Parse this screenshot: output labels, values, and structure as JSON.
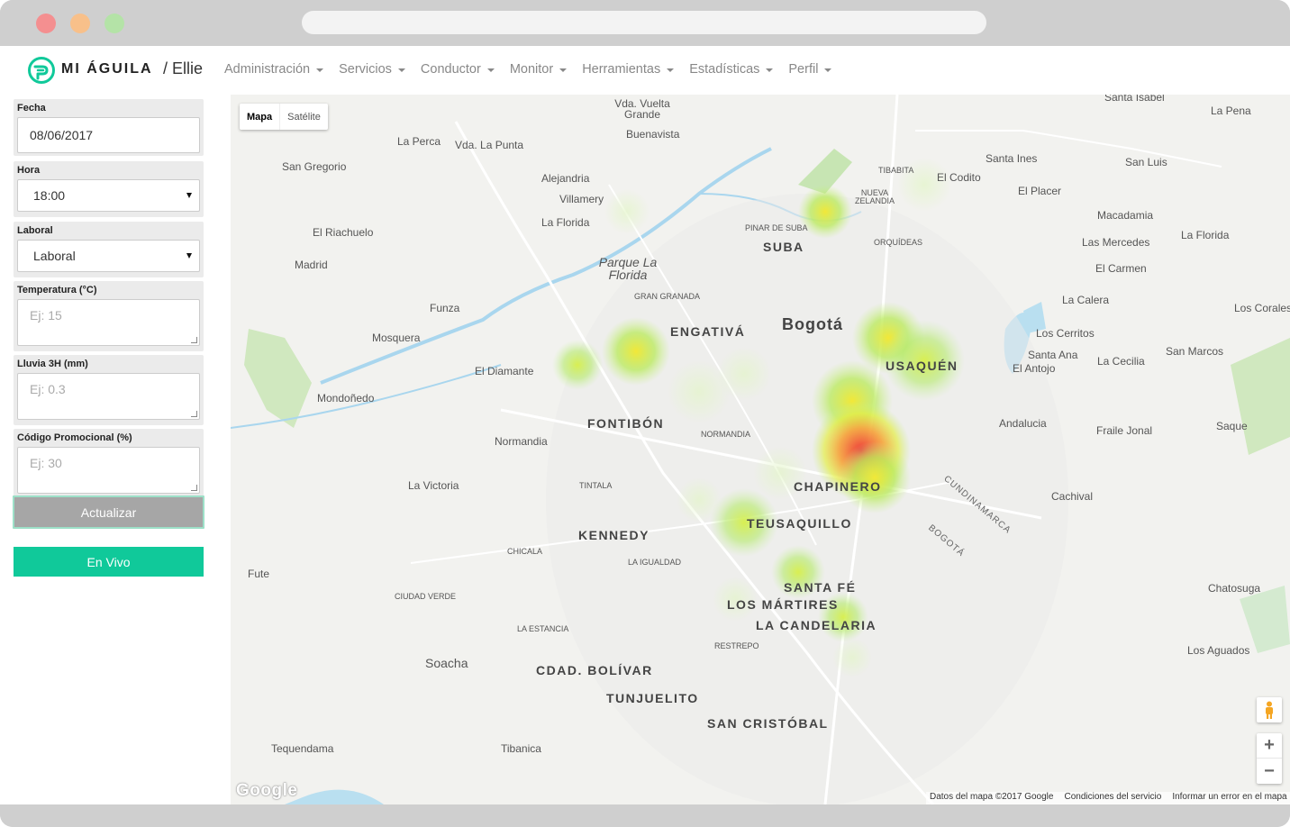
{
  "navbar": {
    "brand": "MI ÁGUILA",
    "crumb": "/ Ellie",
    "menu": [
      "Administración",
      "Servicios",
      "Conductor",
      "Monitor",
      "Herramientas",
      "Estadísticas",
      "Perfil"
    ]
  },
  "form": {
    "fecha": {
      "label": "Fecha",
      "value": "08/06/2017"
    },
    "hora": {
      "label": "Hora",
      "value": "18:00"
    },
    "laboral": {
      "label": "Laboral",
      "value": "Laboral"
    },
    "temperatura": {
      "label": "Temperatura (°C)",
      "placeholder": "Ej: 15"
    },
    "lluvia": {
      "label": "Lluvia 3H (mm)",
      "placeholder": "Ej: 0.3"
    },
    "promo": {
      "label": "Código Promocional (%)",
      "placeholder": "Ej: 30"
    },
    "update_label": "Actualizar",
    "live_label": "En Vivo"
  },
  "map": {
    "type_map": "Mapa",
    "type_satellite": "Satélite",
    "zoom_in": "+",
    "zoom_out": "−",
    "google": "Google",
    "attribution": [
      "Datos del mapa ©2017 Google",
      "Condiciones del servicio",
      "Informar un error en el mapa"
    ],
    "labels": {
      "vuelta_grande": "Vda. Vuelta Grande",
      "la_perca": "La Perca",
      "la_punta": "Vda. La Punta",
      "buenavista": "Buenavista",
      "san_gregorio": "San Gregorio",
      "alejandria": "Alejandria",
      "villamery": "Villamery",
      "la_florida_w": "La Florida",
      "el_riachuelo": "El Riachuelo",
      "madrid": "Madrid",
      "funza": "Funza",
      "mosquera": "Mosquera",
      "el_diamante": "El Diamante",
      "mondonedo": "Mondoñedo",
      "normandia_w": "Normandia",
      "la_victoria": "La Victoria",
      "fute": "Fute",
      "soacha": "Soacha",
      "tequendama": "Tequendama",
      "tibanica": "Tibanica",
      "parque": "Parque La Florida",
      "gran_granada": "GRAN GRANADA",
      "engativa": "ENGATIVÁ",
      "bogota": "Bogotá",
      "suba": "SUBA",
      "pinar": "PINAR DE SUBA",
      "tibabita": "TIBABITA",
      "nueva_zelandia": "NUEVA ZELANDIA",
      "orquideas": "ORQUÍDEAS",
      "el_codito": "El Codito",
      "usaquen": "USAQUÉN",
      "fontibon": "FONTIBÓN",
      "normandia": "NORMANDIA",
      "chapinero": "CHAPINERO",
      "tintala": "TINTALA",
      "kennedy": "KENNEDY",
      "teusaquillo": "TEUSAQUILLO",
      "chicala": "CHICALA",
      "la_igualdad": "LA IGUALDAD",
      "santa_fe": "SANTA FÉ",
      "los_martires": "LOS MÁRTIRES",
      "la_candelaria": "LA CANDELARIA",
      "ciudad_verde": "CIUDAD VERDE",
      "la_estancia": "LA ESTANCIA",
      "restrepo": "RESTREPO",
      "cdad_bolivar": "CDAD. BOLÍVAR",
      "tunjuelito": "TUNJUELITO",
      "san_cristobal": "SAN CRISTÓBAL",
      "santa_isabel": "Santa Isabel",
      "la_pena": "La Pena",
      "santa_ines": "Santa Ines",
      "san_luis": "San Luis",
      "el_placer": "El Placer",
      "macadamia": "Macadamia",
      "las_mercedes": "Las Mercedes",
      "la_florida_e": "La Florida",
      "el_carmen": "El Carmen",
      "la_calera": "La Calera",
      "los_corales": "Los Corales",
      "los_cerritos": "Los Cerritos",
      "santa_ana": "Santa Ana",
      "el_antojo": "El Antojo",
      "la_cecilia": "La Cecilia",
      "san_marcos": "San Marcos",
      "andalucia": "Andalucia",
      "fraile_jonal": "Fraile Jonal",
      "saque": "Saque",
      "cachival": "Cachival",
      "chatosuga": "Chatosuga",
      "los_aguados": "Los Aguados",
      "cundinamarca": "CUNDINAMARCA",
      "bogota_caps": "BOGOTÁ"
    }
  },
  "colors": {
    "accent": "#10c99a",
    "update_btn": "#a6a6a6"
  }
}
